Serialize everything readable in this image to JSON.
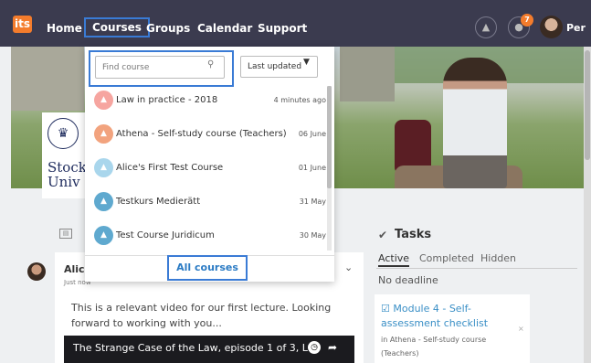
{
  "nav": {
    "logo": "its",
    "items": [
      "Home",
      "Courses",
      "Groups",
      "Calendar",
      "Support"
    ],
    "notification_count": "7",
    "user": "Per"
  },
  "university": {
    "name": "Stock\nUniv"
  },
  "dropdown": {
    "search_placeholder": "Find course",
    "sort_label": "Last updated",
    "courses": [
      {
        "name": "Law in practice - 2018",
        "date": "4 minutes ago",
        "color": "#f6a5a0"
      },
      {
        "name": "Athena - Self-study course (Teachers)",
        "date": "06 June",
        "color": "#f2a37e"
      },
      {
        "name": "Alice's First Test Course",
        "date": "01 June",
        "color": "#a9d6ec"
      },
      {
        "name": "Testkurs Medierätt",
        "date": "31 May",
        "color": "#5fa9cf"
      },
      {
        "name": "Test Course Juridicum",
        "date": "30 May",
        "color": "#5fa9cf"
      }
    ],
    "all_courses": "All courses"
  },
  "feed": {
    "post": {
      "author": "Alic",
      "time": "Just now",
      "text": "This is a relevant video for our first lecture. Looking forward to working with you...",
      "video_title": "The Strange Case of the Law, episode 1 of 3, L..."
    }
  },
  "tasks": {
    "title": "Tasks",
    "tabs": [
      "Active",
      "Completed",
      "Hidden"
    ],
    "no_deadline": "No deadline",
    "item": {
      "title": "Module 4 - Self-assessment checklist",
      "subtitle": "in Athena - Self-study course (Teachers)"
    }
  },
  "colors": {
    "accent": "#3a7bd5",
    "nav_bg": "#3b3b4f",
    "brand": "#f47c2c"
  }
}
